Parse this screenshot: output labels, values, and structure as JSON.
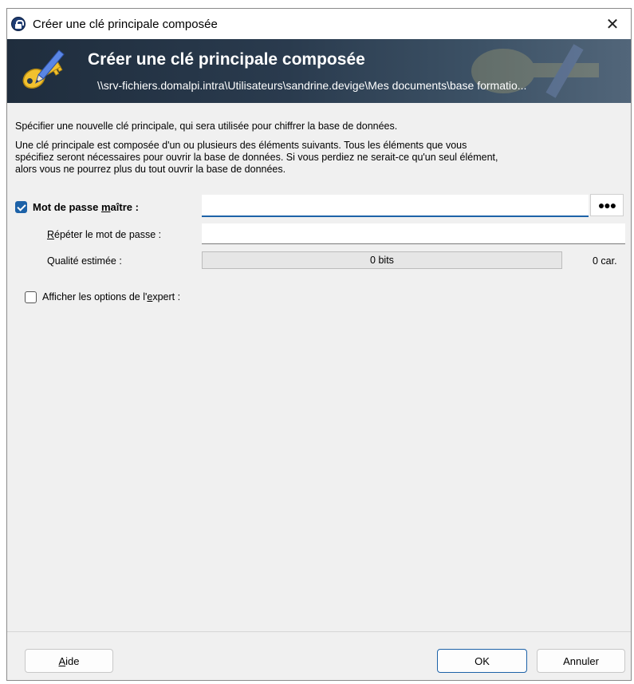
{
  "window": {
    "title": "Créer une clé principale composée",
    "close_glyph": "✕"
  },
  "banner": {
    "title": "Créer une clé principale composée",
    "path": "\\\\srv-fichiers.domalpi.intra\\Utilisateurs\\sandrine.devige\\Mes  documents\\base  formatio...",
    "icon": "key-pen-icon"
  },
  "intro": {
    "line1": "Spécifier une nouvelle clé principale, qui sera utilisée pour chiffrer la base de données.",
    "para2_line1": "Une clé principale est composée d'un ou plusieurs des éléments suivants. Tous les éléments que vous",
    "para2_line2": "spécifiez seront nécessaires pour ouvrir la base de données. Si vous perdiez ne serait-ce qu'un seul élément,",
    "para2_line3": "alors vous ne pourrez plus du tout ouvrir la base de données."
  },
  "master_password": {
    "checked": true,
    "label_prefix": "Mot de passe ",
    "label_accel": "m",
    "label_rest": "aître",
    "label_suffix": " :",
    "value": "",
    "toggle_glyph": "●●●"
  },
  "repeat_password": {
    "label_accel": "R",
    "label_rest": "épéter le mot de passe :",
    "value": ""
  },
  "quality": {
    "label": "Qualité estimée :",
    "bits_text": "0 bits",
    "fill_fraction": 0,
    "chars_text": "0 car."
  },
  "expert_options": {
    "checked": false,
    "label_prefix": "Afficher les options de l'",
    "label_accel": "e",
    "label_rest": "xpert :"
  },
  "buttons": {
    "help_accel": "A",
    "help_rest": "ide",
    "ok": "OK",
    "cancel": "Annuler"
  },
  "colors": {
    "accent": "#1d62a8",
    "banner_dark": "#1f2d3d",
    "dialog_bg": "#f0f0f0"
  }
}
